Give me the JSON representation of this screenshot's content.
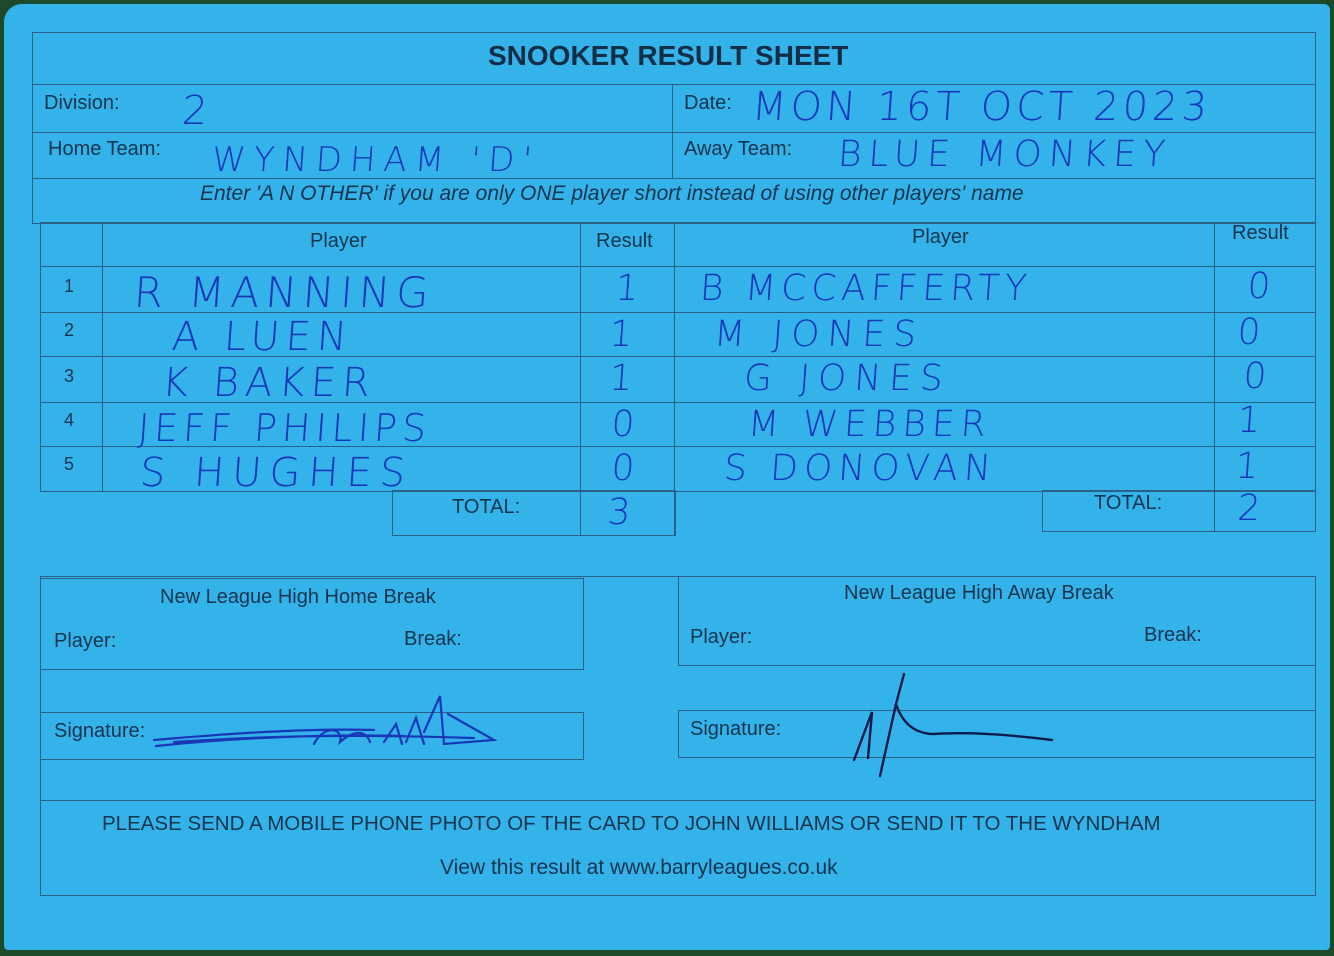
{
  "sheet": {
    "title": "SNOOKER RESULT SHEET",
    "division_label": "Division:",
    "division_value": "2",
    "date_label": "Date:",
    "date_value": "MON 16T OCT 2023",
    "home_team_label": "Home Team:",
    "home_team_value": "WYNDHAM 'D'",
    "away_team_label": "Away Team:",
    "away_team_value": "BLUE MONKEY",
    "instruction": "Enter 'A N OTHER' if you are only ONE player short instead of using other players' name"
  },
  "table": {
    "player_header": "Player",
    "result_header": "Result",
    "rows": [
      {
        "num": "1",
        "home_player": "R MANNING",
        "home_result": "1",
        "away_player": "B MCCAFFERTY",
        "away_result": "0"
      },
      {
        "num": "2",
        "home_player": "A LUEN",
        "home_result": "1",
        "away_player": "M JONES",
        "away_result": "0"
      },
      {
        "num": "3",
        "home_player": "K BAKER",
        "home_result": "1",
        "away_player": "G JONES",
        "away_result": "0"
      },
      {
        "num": "4",
        "home_player": "JEFF PHILIPS",
        "home_result": "0",
        "away_player": "M WEBBER",
        "away_result": "1"
      },
      {
        "num": "5",
        "home_player": "S HUGHES",
        "home_result": "0",
        "away_player": "S DONOVAN",
        "away_result": "1"
      }
    ],
    "total_label": "TOTAL:",
    "home_total": "3",
    "away_total": "2"
  },
  "breaks": {
    "home_title": "New League High Home Break",
    "away_title": "New League High Away Break",
    "player_label": "Player:",
    "break_label": "Break:"
  },
  "signatures": {
    "label": "Signature:"
  },
  "footer": {
    "instruction": "PLEASE SEND A MOBILE PHONE PHOTO OF THE CARD TO JOHN WILLIAMS OR SEND IT TO THE WYNDHAM",
    "website": "View this result at www.barryleagues.co.uk"
  },
  "colors": {
    "card": "#34b3ea",
    "ink": "#1737b8",
    "border": "#2a5f86",
    "background": "#1d4a2a"
  }
}
